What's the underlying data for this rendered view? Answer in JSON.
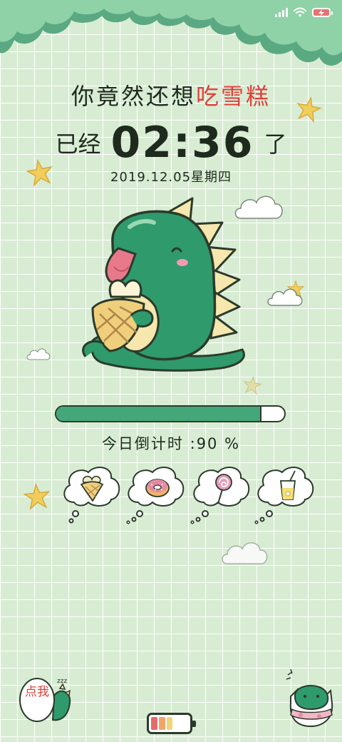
{
  "status_bar": {
    "signal_icon": "signal-bars-icon",
    "wifi_icon": "wifi-icon",
    "battery_icon": "battery-charging-icon",
    "battery_color": "#e57373"
  },
  "lock_screen": {
    "headline_prefix": "你竟然还想",
    "headline_accent": "吃雪糕",
    "time_prefix": "已经",
    "time": "02:36",
    "time_suffix": "了",
    "date": "2019.12.05星期四",
    "countdown_label": "今日倒计时 :90 %",
    "countdown_progress": 0.9,
    "progress_color": "#43a77a",
    "accent_color": "#e0413b"
  },
  "thought_bubbles": [
    {
      "icon": "ice-cream-cone-icon"
    },
    {
      "icon": "donut-icon"
    },
    {
      "icon": "lollipop-icon"
    },
    {
      "icon": "juice-drink-icon"
    }
  ],
  "bottom": {
    "tap_label": "点我",
    "tap_icon": "sleeping-dino-icon",
    "hatch_icon": "hatching-dino-icon",
    "battery_icon": "battery-level-icon"
  }
}
